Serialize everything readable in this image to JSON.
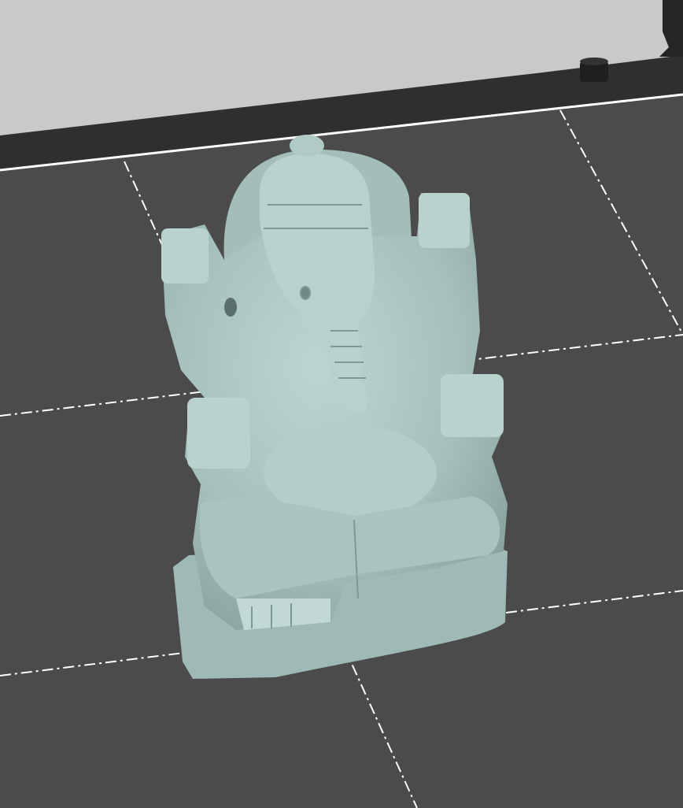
{
  "viewport": {
    "background_color": "#c9c9c9",
    "plate_color": "#4b4b4b",
    "plate_frame_color": "#2f2f2f",
    "grid_line_color": "#ffffff",
    "model_color": "#a8c3bf",
    "model_shadow_color": "#7f9a96"
  }
}
